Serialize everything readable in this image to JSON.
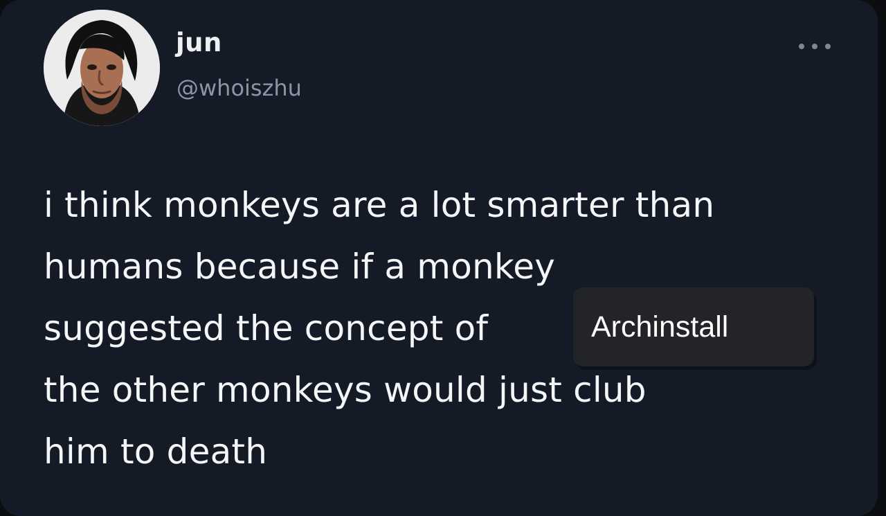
{
  "tweet": {
    "author": {
      "display_name": "jun",
      "handle": "@whoiszhu"
    },
    "text_lines": [
      "i think monkeys are a lot smarter than",
      "humans because if a monkey",
      "suggested the concept of",
      "the other monkeys would just club",
      "him to death"
    ],
    "overlay_label": "Archinstall",
    "actions": {
      "more_icon": "more-options-icon"
    }
  }
}
